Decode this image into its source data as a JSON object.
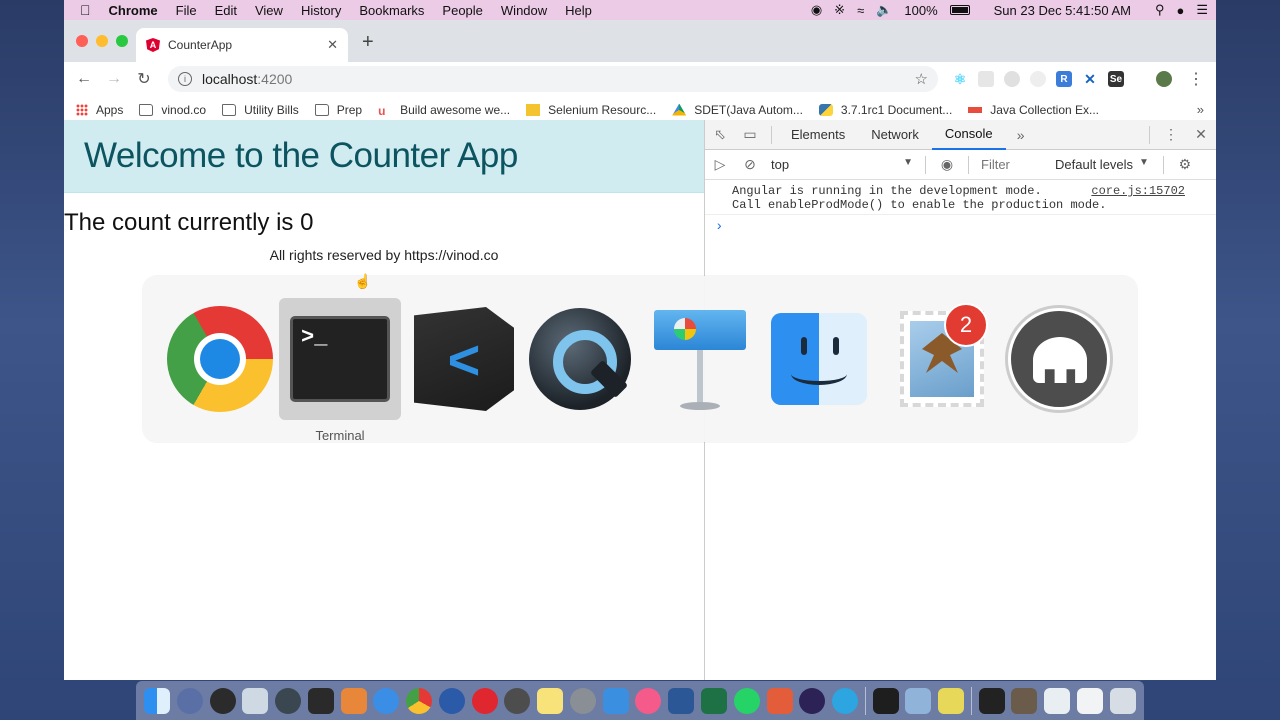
{
  "menubar": {
    "apple": "",
    "app_name": "Chrome",
    "menus": [
      "File",
      "Edit",
      "View",
      "History",
      "Bookmarks",
      "People",
      "Window",
      "Help"
    ],
    "battery": "100%",
    "datetime": "Sun 23 Dec  5:41:50 AM"
  },
  "browser": {
    "tab_title": "CounterApp",
    "tab_favicon": "A",
    "url_host": "localhost",
    "url_port": ":4200",
    "bookmarks": [
      {
        "label": "Apps",
        "icon": "apps-icon"
      },
      {
        "label": "vinod.co",
        "icon": "folder-icon"
      },
      {
        "label": "Utility Bills",
        "icon": "folder-icon"
      },
      {
        "label": "Prep",
        "icon": "folder-icon"
      },
      {
        "label": "Build awesome we...",
        "icon": "udemy-icon"
      },
      {
        "label": "Selenium Resourc...",
        "icon": "stm-icon"
      },
      {
        "label": "SDET(Java Autom...",
        "icon": "drive-icon"
      },
      {
        "label": "3.7.1rc1 Document...",
        "icon": "python-icon"
      },
      {
        "label": "Java Collection Ex...",
        "icon": "java-icon"
      }
    ],
    "bookmarks_more": "»"
  },
  "page": {
    "heading": "Welcome to the Counter App",
    "count_text": "The count currently is 0",
    "footer": "All rights reserved by https://vinod.co"
  },
  "devtools": {
    "tabs": [
      "Elements",
      "Network",
      "Console"
    ],
    "active_tab": "Console",
    "context": "top",
    "filter_placeholder": "Filter",
    "levels": "Default levels",
    "messages": [
      {
        "line1": "Angular is running in the development mode.",
        "line2": "Call enableProdMode() to enable the production mode.",
        "source": "core.js:15702"
      }
    ],
    "prompt": "›"
  },
  "switcher": {
    "apps": [
      "Chrome",
      "Terminal",
      "Visual Studio Code",
      "QuickTime Player",
      "Keynote",
      "Finder",
      "Mail",
      "MAMP"
    ],
    "selected": "Terminal",
    "selected_label": "Terminal",
    "mail_badge": "2",
    "terminal_prompt": ">_"
  },
  "colors": {
    "jumbotron_bg": "#d1ecf1",
    "jumbotron_text": "#0c5460",
    "menubar_bg": "#ebcbe6",
    "devtools_active": "#1a73e8"
  }
}
